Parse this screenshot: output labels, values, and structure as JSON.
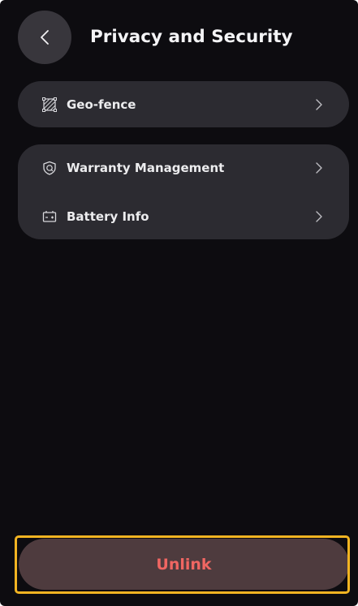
{
  "header": {
    "title": "Privacy and Security"
  },
  "settings_groups": [
    {
      "items": [
        {
          "label": "Geo-fence",
          "icon": "geo-fence-icon"
        }
      ]
    },
    {
      "items": [
        {
          "label": "Warranty Management",
          "icon": "shield-icon"
        },
        {
          "label": "Battery Info",
          "icon": "battery-icon"
        }
      ]
    }
  ],
  "actions": {
    "unlink_label": "Unlink"
  },
  "colors": {
    "background": "#0d0c10",
    "card": "#2c2b31",
    "unlink_bg": "#4e3b3e",
    "unlink_text": "#f06662",
    "highlight": "#f2b422"
  }
}
